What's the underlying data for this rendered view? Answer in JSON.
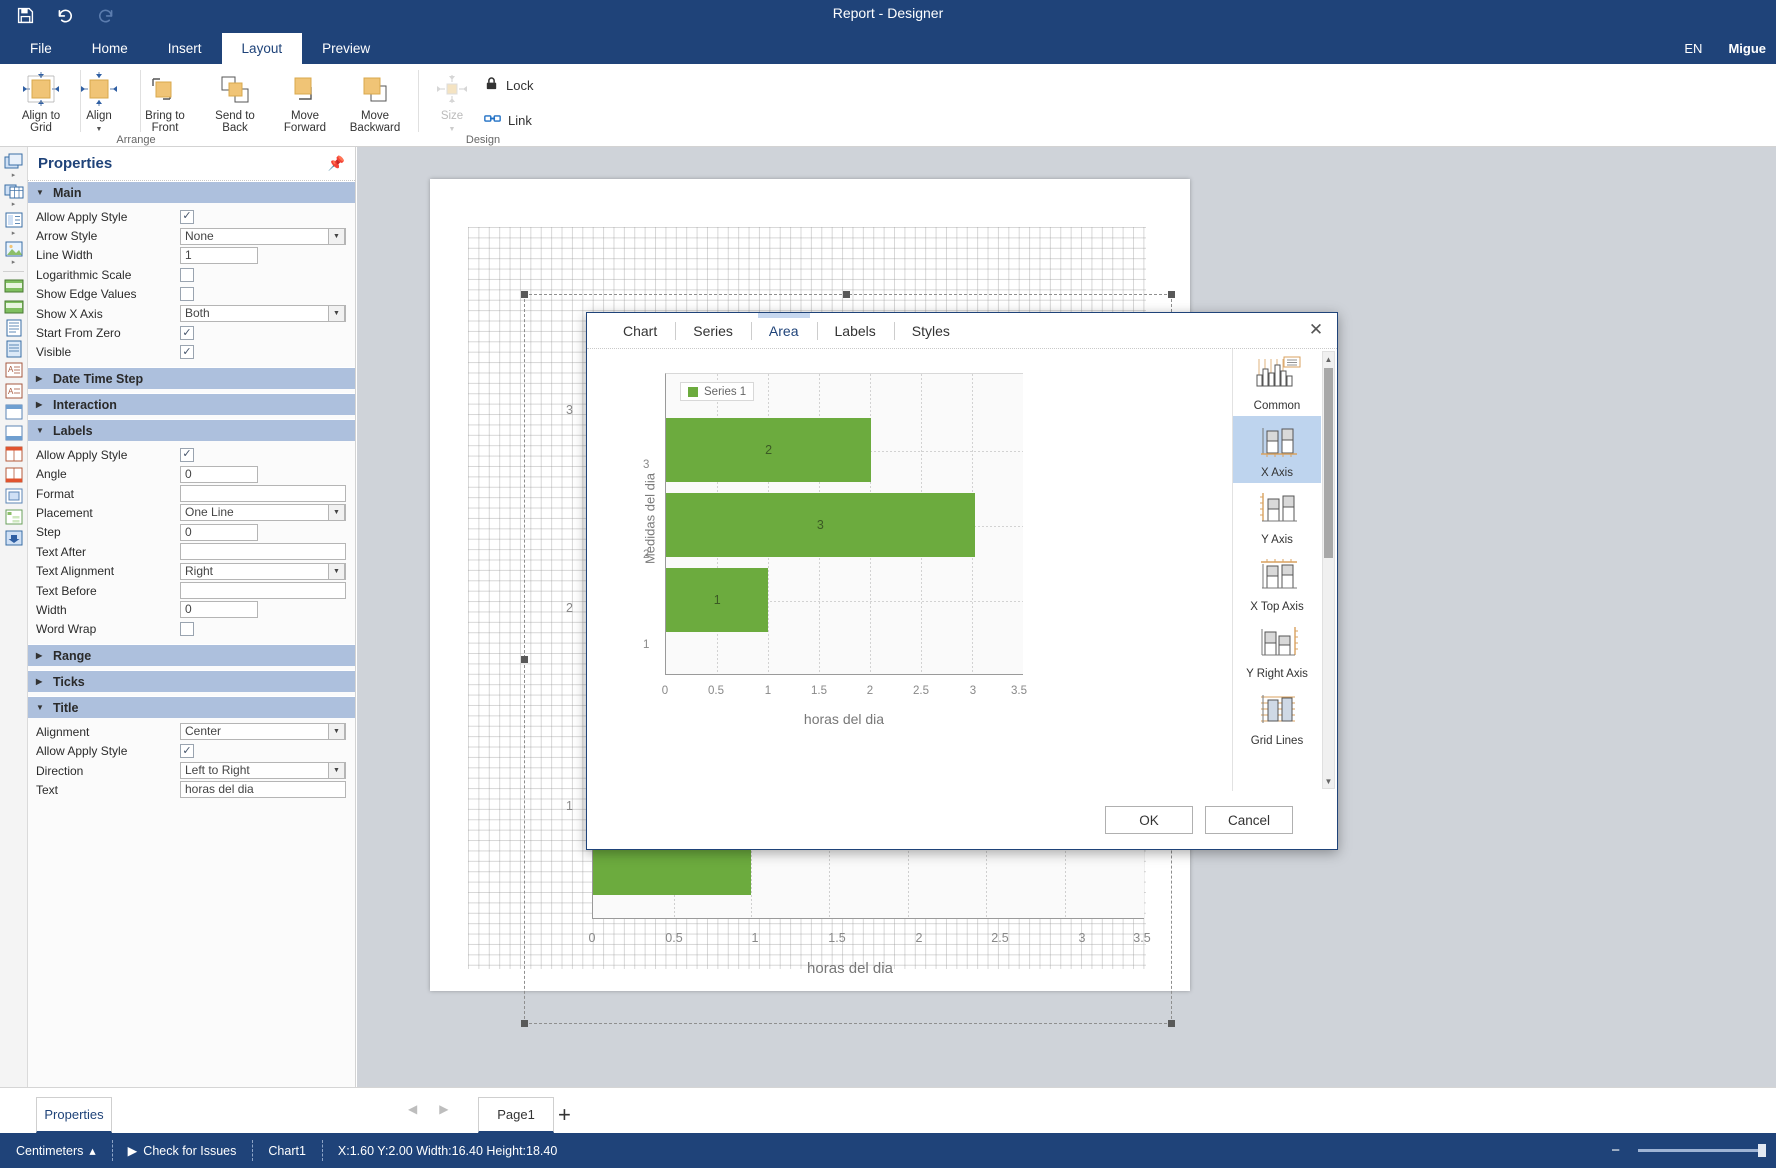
{
  "titlebar": {
    "title": "Report - Designer",
    "icons": [
      {
        "name": "save-icon",
        "glyph": "💾"
      },
      {
        "name": "undo-icon",
        "glyph": "↶"
      },
      {
        "name": "redo-icon",
        "glyph": "↷"
      }
    ]
  },
  "ribbon": {
    "tabs": [
      {
        "label": "File",
        "active": false
      },
      {
        "label": "Home",
        "active": false
      },
      {
        "label": "Insert",
        "active": false
      },
      {
        "label": "Layout",
        "active": true
      },
      {
        "label": "Preview",
        "active": false
      }
    ],
    "language": "EN",
    "user": "Migue",
    "groups": [
      {
        "label": "Arrange"
      },
      {
        "label": "Design"
      }
    ],
    "arrange_items": [
      {
        "label_line1": "Align to",
        "label_line2": "Grid",
        "icon": "align-to-grid-icon"
      },
      {
        "label_line1": "Align",
        "label_line2": "",
        "icon": "align-icon"
      },
      {
        "label_line1": "Bring to",
        "label_line2": "Front",
        "icon": "bring-to-front-icon"
      },
      {
        "label_line1": "Send to",
        "label_line2": "Back",
        "icon": "send-to-back-icon"
      },
      {
        "label_line1": "Move",
        "label_line2": "Forward",
        "icon": "move-forward-icon"
      },
      {
        "label_line1": "Move",
        "label_line2": "Backward",
        "icon": "move-backward-icon"
      }
    ],
    "design_items": [
      {
        "label": "Size",
        "icon": "size-icon",
        "disabled": true
      },
      {
        "label": "Lock",
        "icon": "lock-icon",
        "disabled": false
      },
      {
        "label": "Link",
        "icon": "link-icon",
        "disabled": false
      }
    ]
  },
  "properties": {
    "title": "Properties",
    "pin_icon": "pin-icon",
    "sections": [
      {
        "name": "Main",
        "expanded": true,
        "rows": [
          {
            "key": "Allow Apply Style",
            "type": "checkbox",
            "value": true
          },
          {
            "key": "Arrow Style",
            "type": "combo",
            "value": "None"
          },
          {
            "key": "Line Width",
            "type": "text",
            "value": "1",
            "width": "w78"
          },
          {
            "key": "Logarithmic Scale",
            "type": "checkbox",
            "value": false
          },
          {
            "key": "Show Edge Values",
            "type": "checkbox",
            "value": false
          },
          {
            "key": "Show X Axis",
            "type": "combo",
            "value": "Both"
          },
          {
            "key": "Start From Zero",
            "type": "checkbox",
            "value": true
          },
          {
            "key": "Visible",
            "type": "checkbox",
            "value": true
          }
        ]
      },
      {
        "name": "Date Time Step",
        "expanded": false,
        "rows": []
      },
      {
        "name": "Interaction",
        "expanded": false,
        "rows": []
      },
      {
        "name": "Labels",
        "expanded": true,
        "rows": [
          {
            "key": "Allow Apply Style",
            "type": "checkbox",
            "value": true
          },
          {
            "key": "Angle",
            "type": "text",
            "value": "0",
            "width": "w78"
          },
          {
            "key": "Format",
            "type": "text",
            "value": "",
            "width": "w166"
          },
          {
            "key": "Placement",
            "type": "combo",
            "value": "One Line"
          },
          {
            "key": "Step",
            "type": "text",
            "value": "0",
            "width": "w78"
          },
          {
            "key": "Text After",
            "type": "text",
            "value": "",
            "width": "w166"
          },
          {
            "key": "Text Alignment",
            "type": "combo",
            "value": "Right"
          },
          {
            "key": "Text Before",
            "type": "text",
            "value": "",
            "width": "w166"
          },
          {
            "key": "Width",
            "type": "text",
            "value": "0",
            "width": "w78"
          },
          {
            "key": "Word Wrap",
            "type": "checkbox",
            "value": false
          }
        ]
      },
      {
        "name": "Range",
        "expanded": false,
        "rows": []
      },
      {
        "name": "Ticks",
        "expanded": false,
        "rows": []
      },
      {
        "name": "Title",
        "expanded": true,
        "rows": [
          {
            "key": "Alignment",
            "type": "combo",
            "value": "Center"
          },
          {
            "key": "Allow Apply Style",
            "type": "checkbox",
            "value": true
          },
          {
            "key": "Direction",
            "type": "combo",
            "value": "Left to Right"
          },
          {
            "key": "Text",
            "type": "text",
            "value": "horas del dia",
            "width": "w166"
          }
        ]
      }
    ]
  },
  "dialog": {
    "tabs": [
      {
        "label": "Chart",
        "active": false
      },
      {
        "label": "Series",
        "active": false
      },
      {
        "label": "Area",
        "active": true
      },
      {
        "label": "Labels",
        "active": false
      },
      {
        "label": "Styles",
        "active": false
      }
    ],
    "close_icon": "close-icon",
    "list": [
      {
        "label": "Common",
        "icon": "common-chart-icon",
        "selected": false
      },
      {
        "label": "X Axis",
        "icon": "x-axis-icon",
        "selected": true
      },
      {
        "label": "Y Axis",
        "icon": "y-axis-icon",
        "selected": false
      },
      {
        "label": "X Top Axis",
        "icon": "x-top-axis-icon",
        "selected": false
      },
      {
        "label": "Y Right Axis",
        "icon": "y-right-axis-icon",
        "selected": false
      },
      {
        "label": "Grid Lines",
        "icon": "grid-lines-icon",
        "selected": false
      }
    ],
    "ok_label": "OK",
    "cancel_label": "Cancel"
  },
  "chart_data": {
    "type": "bar",
    "orientation": "horizontal",
    "title": "",
    "categories": [
      "1",
      "2",
      "3"
    ],
    "values": [
      1,
      3,
      2
    ],
    "series": [
      {
        "name": "Series 1",
        "values": [
          1,
          3,
          2
        ],
        "color": "#6cab3e"
      }
    ],
    "xlabel": "horas del dia",
    "ylabel": "Medidas del dia",
    "xticks": [
      "0",
      "0.5",
      "1",
      "1.5",
      "2",
      "2.5",
      "3",
      "3.5"
    ],
    "yticks": [
      "1",
      "2",
      "3"
    ],
    "xlim": [
      0,
      3.5
    ],
    "legend": "Series 1",
    "legend_position": "top-left",
    "grid": true,
    "data_labels": [
      "1",
      "3",
      "2"
    ]
  },
  "bottombar": {
    "properties_tab": "Properties",
    "prev_icon": "chevron-left-icon",
    "next_icon": "chevron-right-icon",
    "page_tab": "Page1",
    "add_page_icon": "plus-icon"
  },
  "statusbar": {
    "units": "Centimeters",
    "units_caret": "▴",
    "check_issues": "Check for Issues",
    "check_issues_icon": "play-icon",
    "selected_object": "Chart1",
    "geometry": "X:1.60 Y:2.00 Width:16.40 Height:18.40",
    "zoom_minus": "−"
  },
  "colors": {
    "brand": "#1f4379",
    "accent_bar": "#6cab3e",
    "section_header": "#adc0dd",
    "selection": "#bed4ee"
  }
}
